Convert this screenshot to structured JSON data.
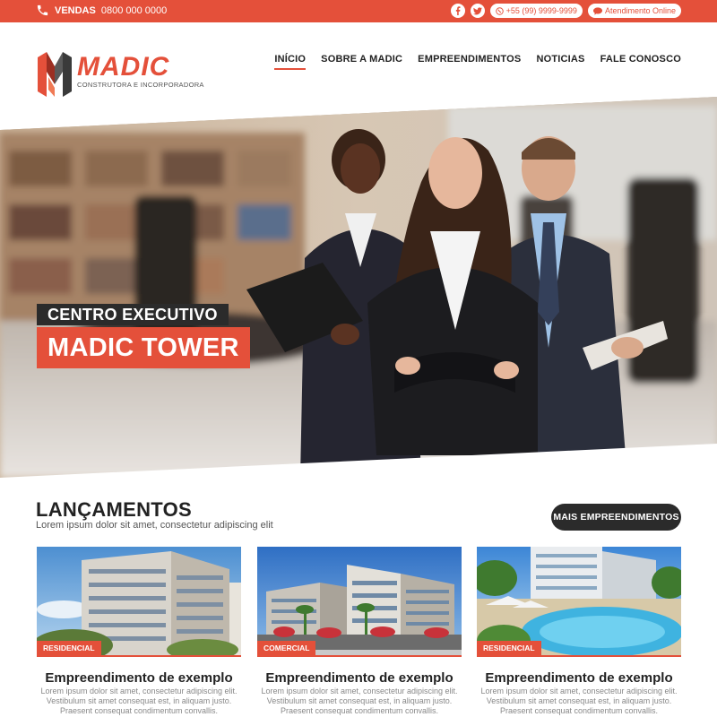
{
  "topbar": {
    "sales_label": "VENDAS",
    "sales_phone": "0800 000 0000",
    "whatsapp": "+55 (99) 9999-9999",
    "online": "Atendimento Online"
  },
  "brand": {
    "name": "MADIC",
    "tagline": "CONSTRUTORA E INCORPORADORA"
  },
  "nav": {
    "items": [
      {
        "label": "INÍCIO"
      },
      {
        "label": "SOBRE A MADIC"
      },
      {
        "label": "EMPREENDIMENTOS"
      },
      {
        "label": "NOTICIAS"
      },
      {
        "label": "FALE CONOSCO"
      }
    ],
    "active": "INÍCIO"
  },
  "hero": {
    "subtitle": "CENTRO EXECUTIVO",
    "title": "MADIC TOWER"
  },
  "launches": {
    "title": "LANÇAMENTOS",
    "subtitle": "Lorem ipsum dolor sit amet, consectetur adipiscing elit",
    "more_button": "MAIS EMPREENDIMENTOS",
    "cards": [
      {
        "badge": "RESIDENCIAL",
        "title": "Empreendimento de exemplo",
        "desc1": "Lorem ipsum dolor sit amet, consectetur adipiscing elit.",
        "desc2": "Vestibulum sit amet consequat est, in aliquam justo.",
        "desc3": "Praesent consequat condimentum convallis."
      },
      {
        "badge": "COMERCIAL",
        "title": "Empreendimento de exemplo",
        "desc1": "Lorem ipsum dolor sit amet, consectetur adipiscing elit.",
        "desc2": "Vestibulum sit amet consequat est, in aliquam justo.",
        "desc3": "Praesent consequat condimentum convallis."
      },
      {
        "badge": "RESIDENCIAL",
        "title": "Empreendimento de exemplo",
        "desc1": "Lorem ipsum dolor sit amet, consectetur adipiscing elit.",
        "desc2": "Vestibulum sit amet consequat est, in aliquam justo.",
        "desc3": "Praesent consequat condimentum convallis."
      }
    ]
  },
  "colors": {
    "accent": "#e4503a",
    "dark": "#2b2b2b"
  },
  "icons": [
    "phone-icon",
    "facebook-icon",
    "twitter-icon",
    "whatsapp-icon",
    "chat-icon"
  ]
}
